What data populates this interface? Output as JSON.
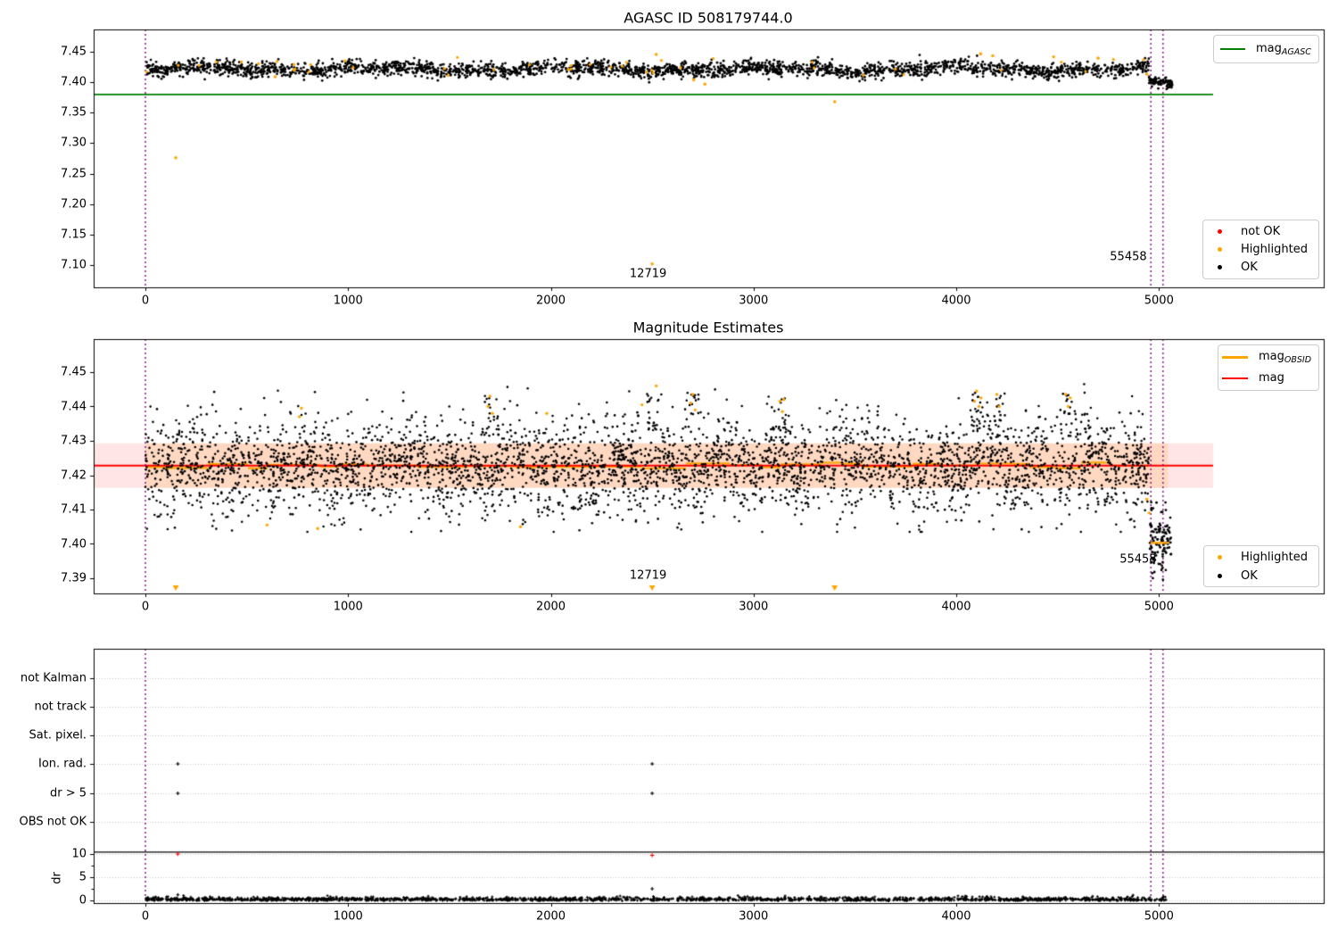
{
  "titles": {
    "top": "AGASC ID 508179744.0",
    "middle": "Magnitude Estimates"
  },
  "colors": {
    "ok": "#000000",
    "highlighted": "#ffa500",
    "not_ok": "#ff0000",
    "mag_agasc": "#007f00",
    "mag": "#ff0000",
    "mag_obsid": "#ffa500",
    "band": "rgba(255,0,0,0.10)",
    "band_overlay": "rgba(255,140,0,0.16)",
    "vline": "#800080",
    "grid": "#c8c8c8",
    "spine": "#000000"
  },
  "legends": {
    "top_line": {
      "main": "mag",
      "sub": "AGASC"
    },
    "top_points": [
      {
        "label": "not OK",
        "color_key": "not_ok"
      },
      {
        "label": "Highlighted",
        "color_key": "highlighted"
      },
      {
        "label": "OK",
        "color_key": "ok"
      }
    ],
    "mid_lines": [
      {
        "main": "mag",
        "sub": "OBSID",
        "color_key": "mag_obsid"
      },
      {
        "main": "mag",
        "sub": "",
        "color_key": "mag"
      }
    ],
    "mid_points": [
      {
        "label": "Highlighted",
        "color_key": "highlighted"
      },
      {
        "label": "OK",
        "color_key": "ok"
      }
    ]
  },
  "chart_data": [
    {
      "type": "scatter",
      "title": "AGASC ID 508179744.0",
      "xlim": [
        -255,
        5815
      ],
      "ylim": [
        7.063,
        7.487
      ],
      "xticks": [
        0,
        1000,
        2000,
        3000,
        4000,
        5000
      ],
      "yticks": [
        7.1,
        7.15,
        7.2,
        7.25,
        7.3,
        7.35,
        7.4,
        7.45
      ],
      "mag_agasc": 7.38,
      "vlines": [
        0,
        4960,
        5020
      ],
      "series_ok_band": {
        "n": 2600,
        "x": [
          0,
          4950
        ],
        "mean": 7.4215,
        "sd": 0.0062,
        "clip": [
          7.398,
          7.4465
        ]
      },
      "series_ok_end": {
        "n": 90,
        "x": [
          4950,
          5065
        ],
        "mean": 7.4035,
        "slope": -6e-05,
        "sd": 0.0042,
        "clip": [
          7.388,
          7.411
        ]
      },
      "series_highlighted_random": {
        "n": 42,
        "x": [
          0,
          4930
        ],
        "mean": 7.4245,
        "sd": 0.0085,
        "clip": [
          7.403,
          7.4465
        ]
      },
      "highlighted_outliers": [
        [
          150,
          7.276
        ],
        [
          2500,
          7.102
        ],
        [
          3400,
          7.368
        ],
        [
          640,
          7.409
        ],
        [
          2520,
          7.4455
        ],
        [
          2705,
          7.404
        ],
        [
          2760,
          7.397
        ],
        [
          4120,
          7.4465
        ],
        [
          4180,
          7.4435
        ],
        [
          4480,
          7.4415
        ],
        [
          4700,
          7.4395
        ],
        [
          4940,
          7.413
        ]
      ],
      "annotations": [
        {
          "text": "12719",
          "x": 2480,
          "y": 7.086
        },
        {
          "text": "55458",
          "x": 4849,
          "y": 7.113
        }
      ]
    },
    {
      "type": "scatter",
      "title": "Magnitude Estimates",
      "xlim": [
        -255,
        5815
      ],
      "ylim": [
        7.3856,
        7.4596
      ],
      "xticks": [
        0,
        1000,
        2000,
        3000,
        4000,
        5000
      ],
      "yticks": [
        7.39,
        7.4,
        7.41,
        7.42,
        7.43,
        7.44,
        7.45
      ],
      "mag": 7.4228,
      "band": [
        7.4163,
        7.4293
      ],
      "vlines": [
        0,
        4960,
        5020
      ],
      "series_ok": {
        "n": 3800,
        "x": [
          0,
          4950
        ],
        "mean": 7.4228,
        "sd": 0.005,
        "tail_frac": 0.16,
        "clip": [
          7.4035,
          7.4465
        ]
      },
      "series_ok_end": {
        "n": 110,
        "x": [
          4955,
          5060
        ],
        "mean": 7.4005,
        "sd": 0.005,
        "clip": [
          7.3875,
          7.4135
        ]
      },
      "spike_x": [
        1700,
        2500,
        2700,
        3140,
        4100,
        4210,
        4550
      ],
      "highlighted_points": [
        [
          760,
          7.437
        ],
        [
          770,
          7.4395
        ],
        [
          1690,
          7.44
        ],
        [
          1700,
          7.443
        ],
        [
          1712,
          7.438
        ],
        [
          1980,
          7.438
        ],
        [
          2450,
          7.4405
        ],
        [
          2520,
          7.446
        ],
        [
          2690,
          7.441
        ],
        [
          2700,
          7.4435
        ],
        [
          2712,
          7.439
        ],
        [
          3130,
          7.4415
        ],
        [
          3142,
          7.4385
        ],
        [
          3150,
          7.442
        ],
        [
          4090,
          7.4415
        ],
        [
          4100,
          7.4445
        ],
        [
          4112,
          7.44
        ],
        [
          4122,
          7.4425
        ],
        [
          4200,
          7.4435
        ],
        [
          4212,
          7.44
        ],
        [
          4540,
          7.4435
        ],
        [
          4552,
          7.44
        ],
        [
          4562,
          7.4425
        ],
        [
          600,
          7.4055
        ],
        [
          850,
          7.4045
        ],
        [
          1850,
          7.405
        ],
        [
          4940,
          7.413
        ],
        [
          4952,
          7.409
        ]
      ],
      "clip_markers_x": [
        150,
        2500,
        3400
      ],
      "obsid_end_segment": {
        "x": [
          4958,
          5048
        ],
        "y": 7.4003
      },
      "annotations": [
        {
          "text": "12719",
          "x": 2480,
          "y": 7.3907
        },
        {
          "text": "55458",
          "x": 4897,
          "y": 7.3955
        }
      ]
    },
    {
      "type": "scatter",
      "title": "",
      "xticks": [
        0,
        1000,
        2000,
        3000,
        4000,
        5000
      ],
      "categories": [
        "not Kalman",
        "not track",
        "Sat. pixel.",
        "Ion. rad.",
        "dr > 5",
        "OBS not OK"
      ],
      "dr_ticks": [
        10,
        5,
        0
      ],
      "ylabel": "dr",
      "vlines": [
        0,
        4960,
        5020
      ],
      "baseline": {
        "n": 1700,
        "x": [
          0,
          5040
        ],
        "sd": 0.33,
        "clip": 1.2
      },
      "flag_events": [
        {
          "x": 160,
          "flags": [
            "Ion. rad.",
            "dr > 5"
          ]
        },
        {
          "x": 2500,
          "flags": [
            "Ion. rad.",
            "dr > 5"
          ]
        }
      ],
      "not_ok_dr": [
        [
          160,
          10.0
        ],
        [
          2500,
          9.7
        ]
      ],
      "ok_dr_outliers": [
        [
          160,
          1.2
        ],
        [
          2500,
          2.5
        ]
      ],
      "dr_hline": 10.4
    }
  ]
}
